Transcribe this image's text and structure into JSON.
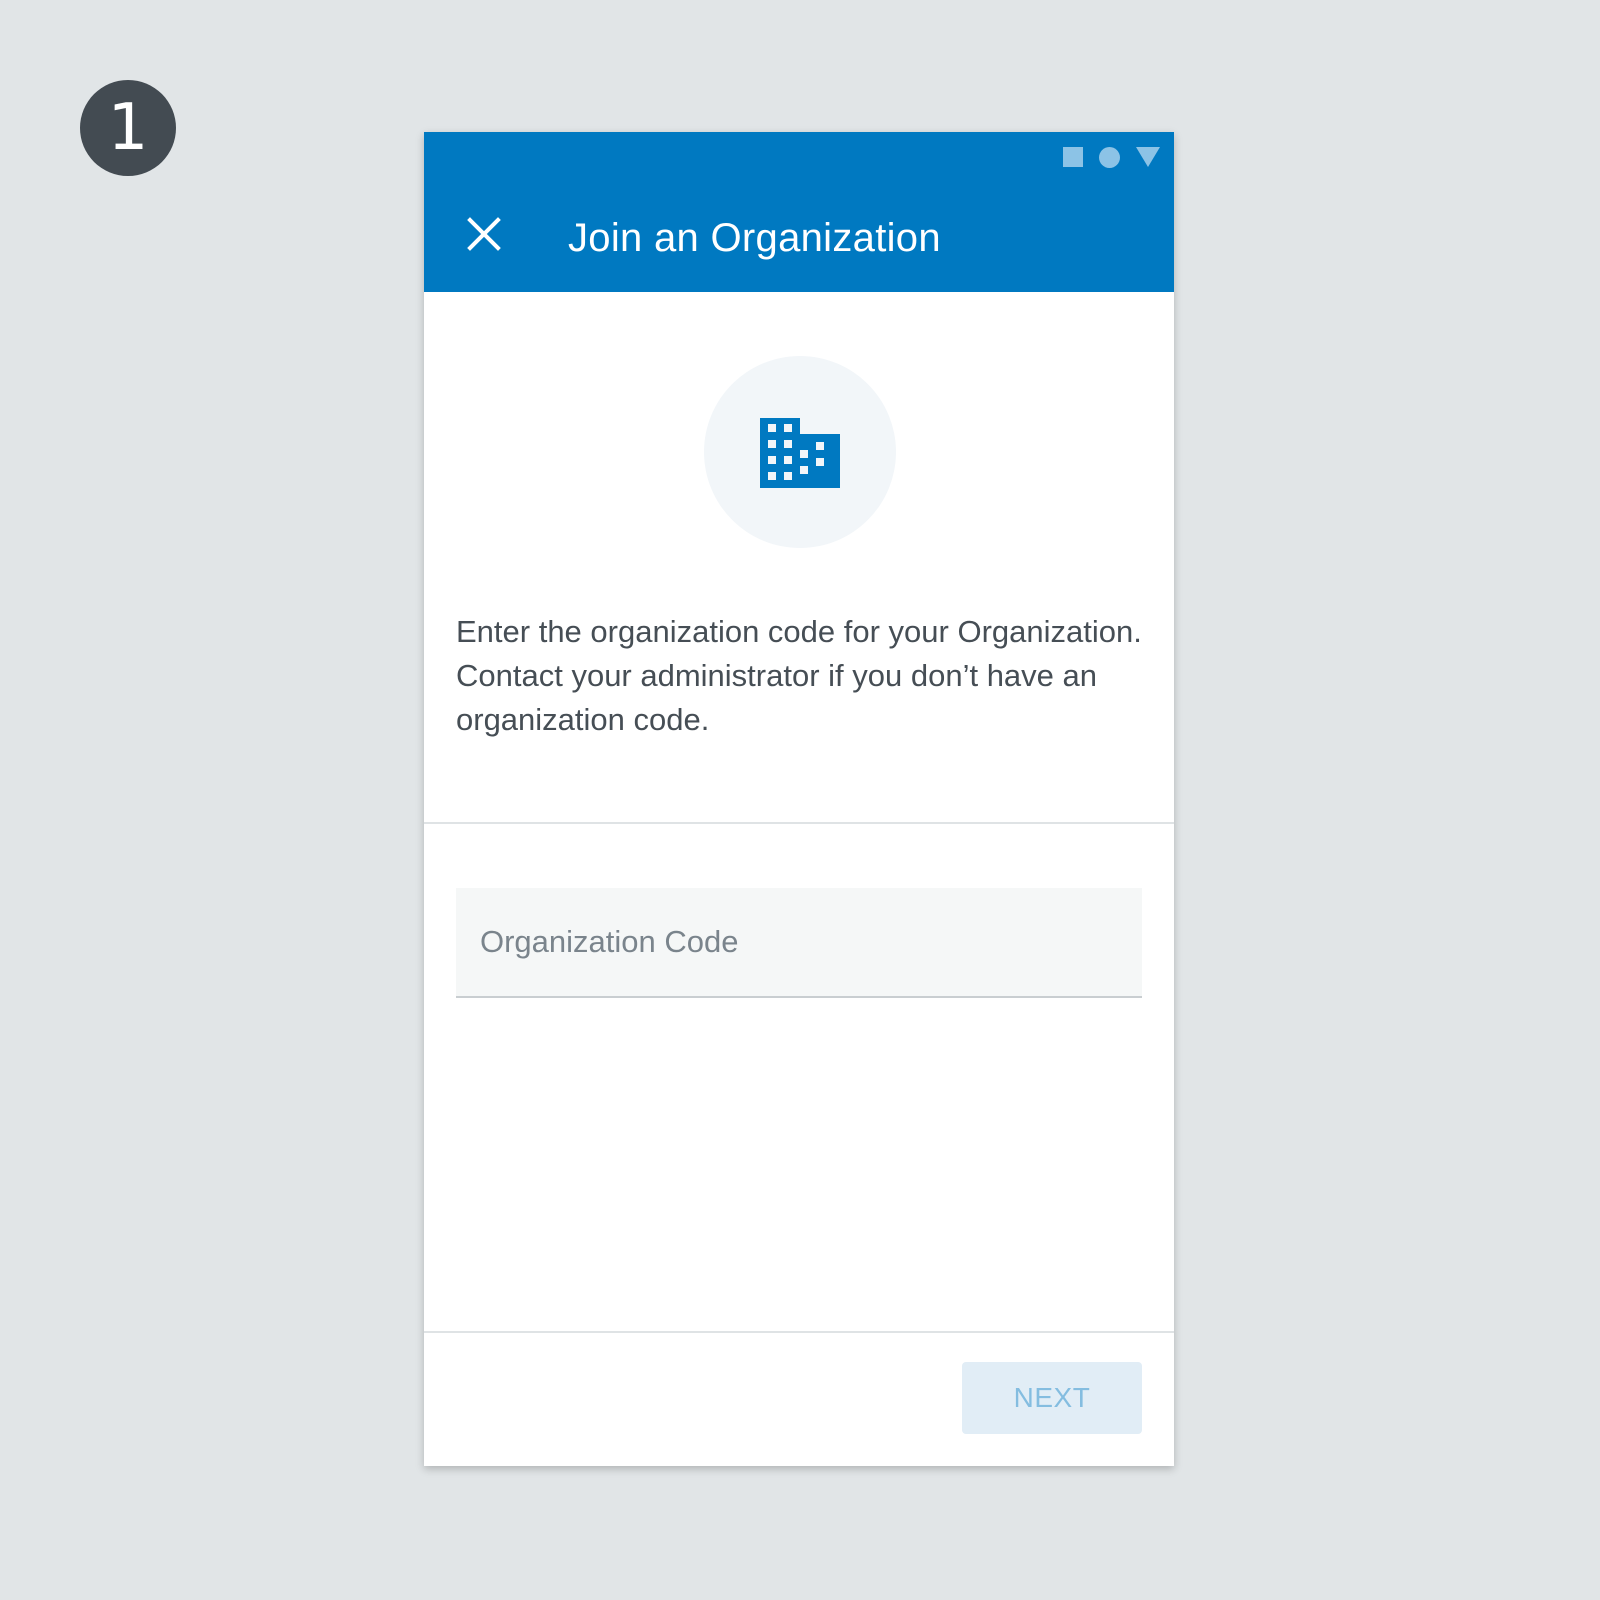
{
  "step": {
    "number": "1"
  },
  "status_bar": {
    "icons": [
      "square-icon",
      "circle-icon",
      "triangle-icon"
    ],
    "color": "#8cc3e6"
  },
  "appbar": {
    "title": "Join an Organization",
    "close_icon": "close-icon",
    "background": "#0079c1"
  },
  "hero": {
    "icon": "building-icon",
    "icon_color": "#0079c1",
    "circle_color": "#f2f6f9"
  },
  "main": {
    "description": "Enter the organization code for your Organization. Contact your administrator if you don’t have an organization code."
  },
  "form": {
    "code_value": "",
    "code_placeholder": "Organization Code"
  },
  "footer": {
    "next_label": "NEXT",
    "next_enabled": false
  }
}
